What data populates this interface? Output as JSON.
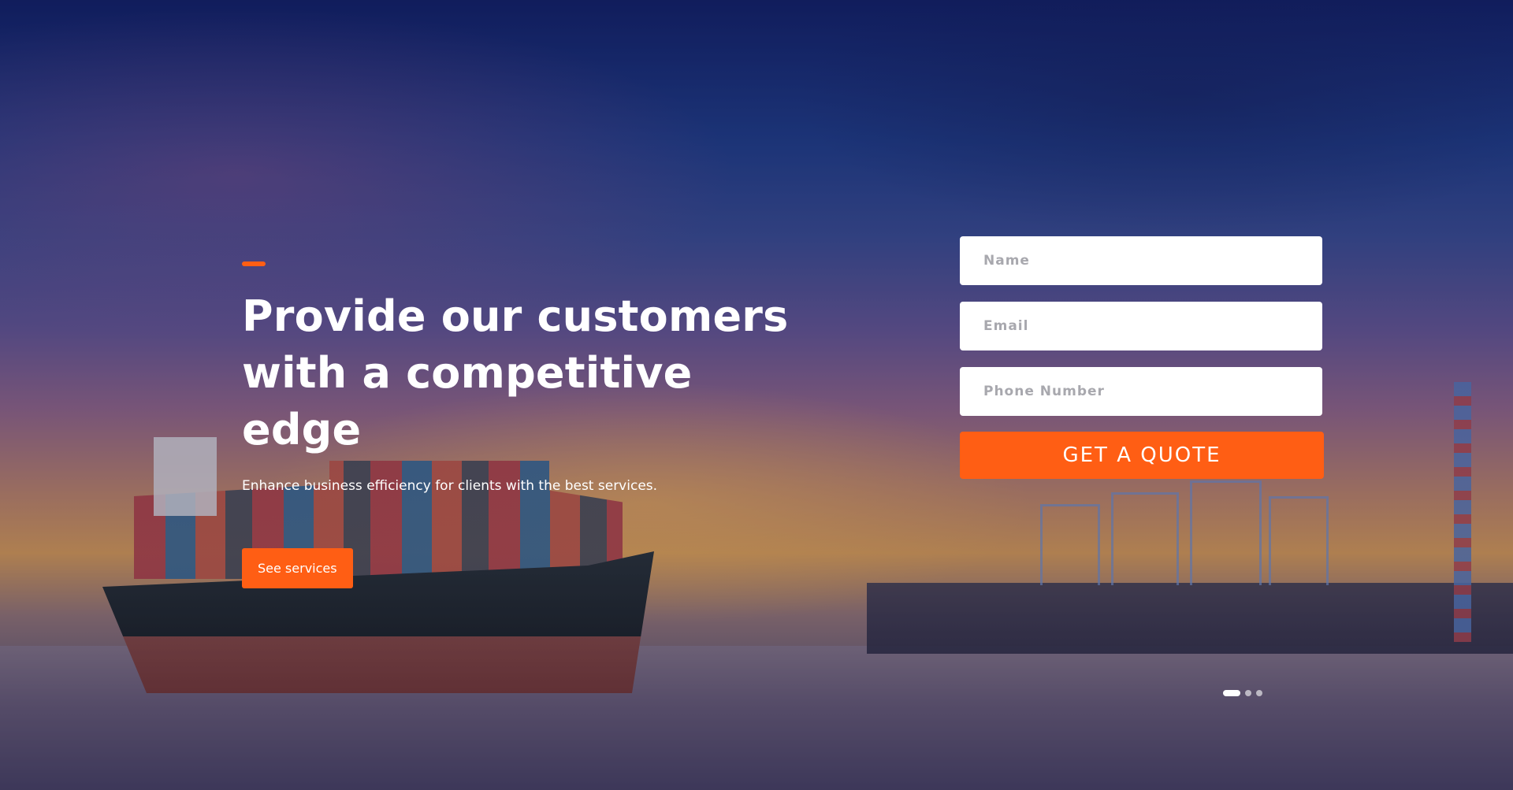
{
  "hero": {
    "headline_line1": "Provide our customers",
    "headline_line2": "with a competitive edge",
    "subtext": "Enhance business efficiency for clients with the best services.",
    "cta_label": "See services",
    "background_image": "cargo-ship-port-sunset"
  },
  "quote_form": {
    "name_placeholder": "Name",
    "email_placeholder": "Email",
    "phone_placeholder": "Phone Number",
    "submit_label": "GET A QUOTE"
  },
  "slider": {
    "slide_count": 3,
    "active_slide": 1
  },
  "colors": {
    "accent": "#ff5e14",
    "text_light": "#ffffff",
    "input_bg": "#ffffff",
    "placeholder": "#a8a8ae"
  }
}
